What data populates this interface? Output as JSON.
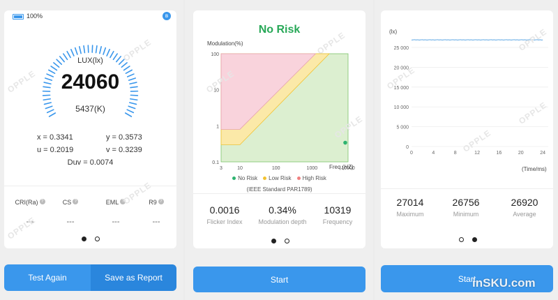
{
  "status": {
    "battery": "100%",
    "bluetooth_icon": "bluetooth-icon",
    "battery_icon": "battery-icon"
  },
  "watermark": "OPPLE",
  "gauge": {
    "label": "LUX(lx)",
    "value": "24060",
    "cct": "5437(K)"
  },
  "coords": {
    "x": "x = 0.3341",
    "y": "y = 0.3573",
    "u": "u = 0.2019",
    "v": "v = 0.3239",
    "duv": "Duv = 0.0074"
  },
  "indices": [
    {
      "label": "CRI(Ra)",
      "value": "---"
    },
    {
      "label": "CS",
      "value": "---"
    },
    {
      "label": "EML",
      "value": "---"
    },
    {
      "label": "R9",
      "value": "---"
    }
  ],
  "left_buttons": {
    "test_again": "Test Again",
    "save_report": "Save as Report"
  },
  "flicker": {
    "title": "No Risk",
    "y_axis_label": "Modulation(%)",
    "x_axis_label": "Freq.(HZ)",
    "y_ticks": [
      "100",
      "10",
      "1",
      "0.1"
    ],
    "x_ticks": [
      "3",
      "10",
      "100",
      "1000",
      "10000"
    ],
    "legend": [
      {
        "name": "No Risk",
        "color": "#2db36f"
      },
      {
        "name": "Low Risk",
        "color": "#f2c230"
      },
      {
        "name": "High Risk",
        "color": "#f08080"
      }
    ],
    "standard": "(IEEE Standard PAR1789)",
    "stats": [
      {
        "value": "0.0016",
        "label": "Flicker Index"
      },
      {
        "value": "0.34%",
        "label": "Modulation depth"
      },
      {
        "value": "10319",
        "label": "Frequency"
      }
    ],
    "start": "Start"
  },
  "timeline": {
    "y_unit": "(lx)",
    "x_unit": "(Time/ms)",
    "y_ticks": [
      "25 000",
      "20 000",
      "15 000",
      "10 000",
      "5 000",
      "0"
    ],
    "x_ticks": [
      "0",
      "4",
      "8",
      "12",
      "16",
      "20",
      "24"
    ],
    "stats": [
      {
        "value": "27014",
        "label": "Maximum"
      },
      {
        "value": "26756",
        "label": "Minimum"
      },
      {
        "value": "26920",
        "label": "Average"
      }
    ],
    "start": "Start",
    "brand": "inSKU.com"
  },
  "chart_data": [
    {
      "type": "scatter",
      "xlabel": "Freq.(HZ)",
      "ylabel": "Modulation(%)",
      "x_scale": "log",
      "y_scale": "log",
      "xlim": [
        3,
        10000
      ],
      "ylim": [
        0.1,
        100
      ],
      "series": [
        {
          "name": "",
          "points": [
            {
              "x": 10319,
              "y": 0.34
            }
          ]
        }
      ],
      "legend": [
        "No Risk",
        "Low Risk",
        "High Risk"
      ]
    },
    {
      "type": "line",
      "xlabel": "(Time/ms)",
      "ylabel": "(lx)",
      "xlim": [
        0,
        25
      ],
      "ylim": [
        0,
        28000
      ],
      "grid": true,
      "series": [
        {
          "name": "",
          "x": [
            0,
            24
          ],
          "y": [
            26920,
            26920
          ]
        }
      ]
    }
  ]
}
